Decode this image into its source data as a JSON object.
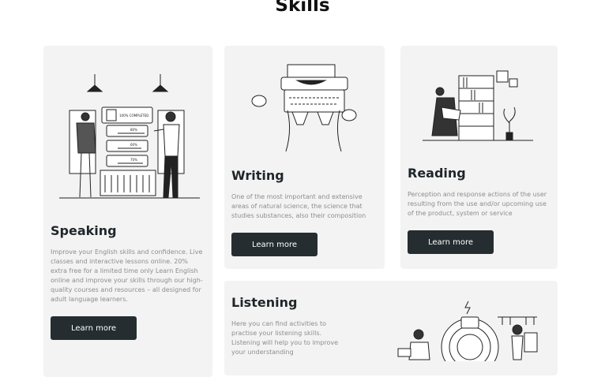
{
  "page": {
    "title": "Skills"
  },
  "cards": {
    "speaking": {
      "title": "Speaking",
      "description": "Improve your English skills and confidence. Live classes and interactive lessons online. 20% extra free for a limited time only Learn English online and improve your skills through our high-quality courses and resources – all designed for adult language learners.",
      "button": "Learn more",
      "illustration_labels": {
        "progress_title": "100% COMPLETED",
        "bar1": "80%",
        "bar2": "60%",
        "bar3": "70%"
      }
    },
    "writing": {
      "title": "Writing",
      "description": "One of the most important and extensive areas of natural science, the science that studies substances, also their composition",
      "button": "Learn more"
    },
    "reading": {
      "title": "Reading",
      "description": "Perception and response actions of the user resulting from the use and/or upcoming use of the product, system or service",
      "button": "Learn more"
    },
    "listening": {
      "title": "Listening",
      "description": "Here you can find activities to practise your listening skills. Listening will help you to improve your understanding",
      "button": "Learn more"
    }
  },
  "colors": {
    "card_bg": "#f3f3f3",
    "button_bg": "#252d31",
    "button_text": "#ffffff",
    "heading": "#1f2629",
    "body_text": "#8d8d8d"
  }
}
